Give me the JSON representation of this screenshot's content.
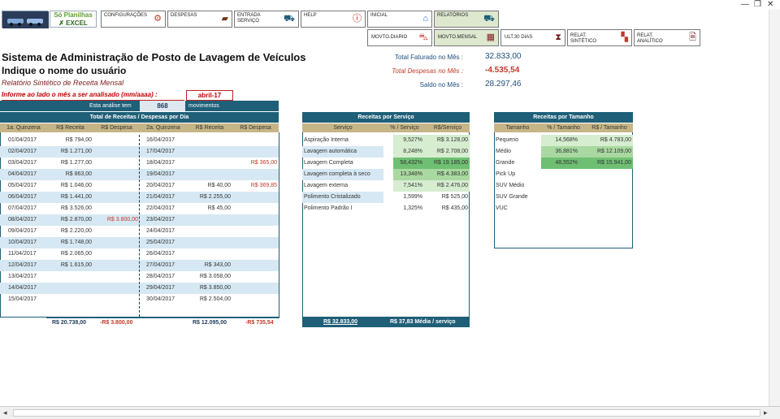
{
  "window": {
    "minimize": "—",
    "restore": "❐",
    "close": "✕"
  },
  "logo": {
    "line1": "Só Planilhas",
    "line2": "EXCEL"
  },
  "nav": {
    "configuracoes": "CONFIGURAÇÕES",
    "despesas": "DESPESAS",
    "entrada_servico_l1": "ENTRADA",
    "entrada_servico_l2": "SERVIÇO",
    "help": "HELP",
    "inicial": "INICIAL",
    "relatorios": "RELATÓRIOS",
    "movto_diario": "MOVTO.DIARIO",
    "movto_mensal": "MOVTO.MENSAL",
    "ult30": "ULT.30 DIAS",
    "relat_sintetico_l1": "RELAT.",
    "relat_sintetico_l2": "SINTÉTICO",
    "relat_analitico_l1": "RELAT.",
    "relat_analitico_l2": "ANALÍTICO"
  },
  "header": {
    "title": "Sistema de Administração de Posto de Lavagem de Veículos",
    "user_prompt": "Indique o nome do usuário",
    "report_name": "Relatório Sintético de Receita Mensal",
    "inform_label": "Informe ao lado o mês a ser analisado (mm/aaaa) :",
    "mes_value": "abril-17",
    "analise_label": "Esta análise tem",
    "analise_count": "868",
    "analise_suffix": "movimentos"
  },
  "summary": {
    "faturado_label": "Total Faturado no Mês :",
    "faturado_value": "32.833,00",
    "despesas_label": "Total Despesas no Mês :",
    "despesas_value": "-4.535,54",
    "saldo_label": "Saldo no Mês :",
    "saldo_value": "28.297,46"
  },
  "daily": {
    "title": "Total de Receitas / Despesas por Dia",
    "headers": [
      "1a. Quinzena",
      "R$ Receita",
      "R$ Despesa",
      "2a. Quinzena",
      "R$ Receita",
      "R$ Despesa"
    ],
    "rows": [
      [
        "01/04/2017",
        "R$ 794,00",
        "",
        "16/04/2017",
        "",
        ""
      ],
      [
        "02/04/2017",
        "R$ 1.271,00",
        "",
        "17/04/2017",
        "",
        ""
      ],
      [
        "03/04/2017",
        "R$ 1.277,00",
        "",
        "18/04/2017",
        "",
        "R$ 365,00"
      ],
      [
        "04/04/2017",
        "R$ 863,00",
        "",
        "19/04/2017",
        "",
        ""
      ],
      [
        "05/04/2017",
        "R$ 1.046,00",
        "",
        "20/04/2017",
        "R$ 40,00",
        "R$ 369,85"
      ],
      [
        "06/04/2017",
        "R$ 1.441,00",
        "",
        "21/04/2017",
        "R$ 2.255,00",
        ""
      ],
      [
        "07/04/2017",
        "R$ 3.526,00",
        "",
        "22/04/2017",
        "R$ 45,00",
        ""
      ],
      [
        "08/04/2017",
        "R$ 2.870,00",
        "R$ 3.800,00",
        "23/04/2017",
        "",
        ""
      ],
      [
        "09/04/2017",
        "R$ 2.220,00",
        "",
        "24/04/2017",
        "",
        ""
      ],
      [
        "10/04/2017",
        "R$ 1.748,00",
        "",
        "25/04/2017",
        "",
        ""
      ],
      [
        "11/04/2017",
        "R$ 2.065,00",
        "",
        "26/04/2017",
        "",
        ""
      ],
      [
        "12/04/2017",
        "R$ 1.615,00",
        "",
        "27/04/2017",
        "R$ 343,00",
        ""
      ],
      [
        "13/04/2017",
        "",
        "",
        "28/04/2017",
        "R$ 3.058,00",
        ""
      ],
      [
        "14/04/2017",
        "",
        "",
        "29/04/2017",
        "R$ 3.850,00",
        ""
      ],
      [
        "15/04/2017",
        "",
        "",
        "30/04/2017",
        "R$ 2.504,00",
        ""
      ]
    ],
    "totals": [
      "R$ 20.738,00",
      "-R$ 3.800,00",
      "R$ 12.095,00",
      "-R$ 735,54"
    ]
  },
  "servico": {
    "title": "Receitas por Serviço",
    "headers": [
      "Serviço",
      "% / Serviço",
      "R$/Serviço"
    ],
    "rows": [
      [
        "Aspiração Interna",
        "9,527%",
        "R$ 3.128,00"
      ],
      [
        "Lavagem automática",
        "8,248%",
        "R$ 2.708,00"
      ],
      [
        "Lavagem Completa",
        "58,432%",
        "R$ 19.185,00"
      ],
      [
        "Lavagem completa à seco",
        "13,348%",
        "R$ 4.383,00"
      ],
      [
        "Lavagem externa",
        "7,541%",
        "R$ 2.476,00"
      ],
      [
        "Polimento Cristalizado",
        "1,599%",
        "R$ 525,00"
      ],
      [
        "Polimento Padrão I",
        "1,325%",
        "R$ 435,00"
      ]
    ],
    "total": "R$ 32.833,00",
    "media": "R$ 37,83 Média / serviço"
  },
  "tamanho": {
    "title": "Receitas  por Tamanho",
    "headers": [
      "Tamanho",
      "% / Tamanho",
      "R$ / Tamanho"
    ],
    "rows": [
      [
        "Pequeno",
        "14,568%",
        "R$ 4.783,00"
      ],
      [
        "Médio",
        "36,881%",
        "R$ 12.109,00"
      ],
      [
        "Grande",
        "48,552%",
        "R$ 15.941,00"
      ],
      [
        "Pick Up",
        "",
        ""
      ],
      [
        "SUV Médio",
        "",
        ""
      ],
      [
        "SUV Grande",
        "",
        ""
      ],
      [
        "VUC",
        "",
        ""
      ]
    ]
  },
  "colors": {
    "dark_teal": "#1f5f78",
    "tan": "#c6b687",
    "light_blue": "#d6e8f3",
    "red": "#c0392b"
  }
}
